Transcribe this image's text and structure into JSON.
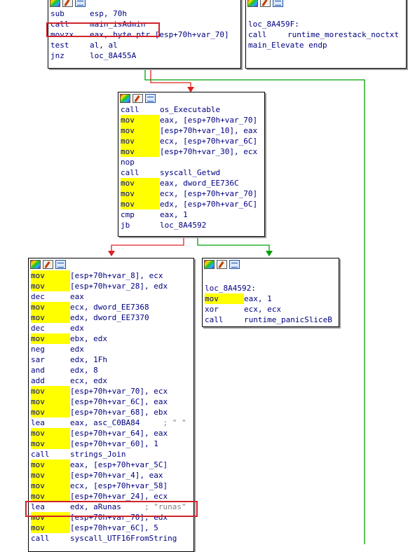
{
  "nodes": {
    "top_left": {
      "lines": [
        {
          "m": "sub",
          "o": "esp, 70h"
        },
        {
          "m": "call",
          "o": "main_isAdmin"
        },
        {
          "m": "movzx",
          "o": "eax, byte ptr [esp+70h+var_70]"
        },
        {
          "m": "test",
          "o": "al, al"
        },
        {
          "m": "jnz",
          "o": "loc_8A455A"
        }
      ]
    },
    "top_right": {
      "lines": [
        {
          "label": "loc_8A459F:"
        },
        {
          "m": "call",
          "o": "runtime_morestack_noctxt"
        },
        {
          "label": "main_Elevate endp"
        }
      ]
    },
    "middle": {
      "lines": [
        {
          "m": "call",
          "o": "os_Executable"
        },
        {
          "m": "mov",
          "o": "eax, [esp+70h+var_70]"
        },
        {
          "m": "mov",
          "o": "[esp+70h+var_10], eax"
        },
        {
          "m": "mov",
          "o": "ecx, [esp+70h+var_6C]"
        },
        {
          "m": "mov",
          "o": "[esp+70h+var_30], ecx"
        },
        {
          "m": "nop",
          "o": ""
        },
        {
          "m": "call",
          "o": "syscall_Getwd"
        },
        {
          "m": "mov",
          "o": "eax, dword_EE736C"
        },
        {
          "m": "mov",
          "o": "ecx, [esp+70h+var_70]"
        },
        {
          "m": "mov",
          "o": "edx, [esp+70h+var_6C]"
        },
        {
          "m": "cmp",
          "o": "eax, 1"
        },
        {
          "m": "jb",
          "o": "loc_8A4592"
        }
      ]
    },
    "bottom_right": {
      "lines": [
        {
          "label": "loc_8A4592:"
        },
        {
          "m": "mov",
          "o": "eax, 1"
        },
        {
          "m": "xor",
          "o": "ecx, ecx"
        },
        {
          "m": "call",
          "o": "runtime_panicSliceB"
        }
      ]
    },
    "bottom_left": {
      "lines": [
        {
          "m": "mov",
          "o": "[esp+70h+var_8], ecx"
        },
        {
          "m": "mov",
          "o": "[esp+70h+var_28], edx"
        },
        {
          "m": "dec",
          "o": "eax"
        },
        {
          "m": "mov",
          "o": "ecx, dword_EE7368"
        },
        {
          "m": "mov",
          "o": "edx, dword_EE7370"
        },
        {
          "m": "dec",
          "o": "edx"
        },
        {
          "m": "mov",
          "o": "ebx, edx"
        },
        {
          "m": "neg",
          "o": "edx"
        },
        {
          "m": "sar",
          "o": "edx, 1Fh"
        },
        {
          "m": "and",
          "o": "edx, 8"
        },
        {
          "m": "add",
          "o": "ecx, edx"
        },
        {
          "m": "mov",
          "o": "[esp+70h+var_70], ecx"
        },
        {
          "m": "mov",
          "o": "[esp+70h+var_6C], eax"
        },
        {
          "m": "mov",
          "o": "[esp+70h+var_68], ebx"
        },
        {
          "m": "lea",
          "o": "eax, asc_C0BA84",
          "c": "; \" \""
        },
        {
          "m": "mov",
          "o": "[esp+70h+var_64], eax"
        },
        {
          "m": "mov",
          "o": "[esp+70h+var_60], 1"
        },
        {
          "m": "call",
          "o": "strings_Join"
        },
        {
          "m": "mov",
          "o": "eax, [esp+70h+var_5C]"
        },
        {
          "m": "mov",
          "o": "[esp+70h+var_4], eax"
        },
        {
          "m": "mov",
          "o": "ecx, [esp+70h+var_58]"
        },
        {
          "m": "mov",
          "o": "[esp+70h+var_24], ecx"
        },
        {
          "m": "lea",
          "o": "edx, aRunas",
          "c": "; \"runas\""
        },
        {
          "m": "mov",
          "o": "[esp+70h+var_70], edx"
        },
        {
          "m": "mov",
          "o": "[esp+70h+var_6C], 5"
        },
        {
          "m": "call",
          "o": "syscall_UTF16FromString"
        }
      ]
    }
  },
  "colors": {
    "highlight_box": "#d0232b",
    "mov_highlight": "#ffff00",
    "edge_true": "#00a000",
    "edge_false": "#e02020",
    "edge_neutral": "#208020"
  },
  "icons": [
    "graph-overview-icon",
    "edit-node-icon",
    "node-color-icon"
  ]
}
